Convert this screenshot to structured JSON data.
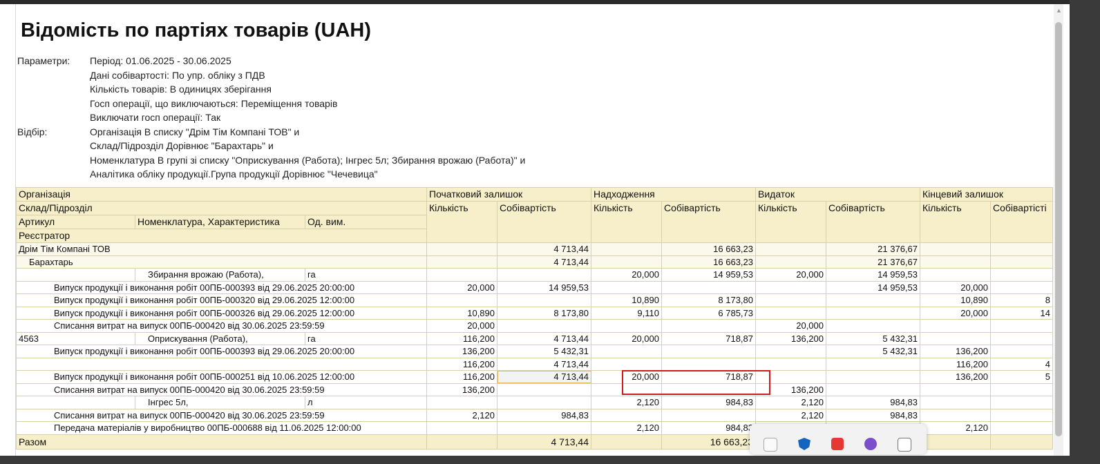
{
  "title": "Відомість по партіях товарів (UAH)",
  "params": [
    {
      "label": "Параметри:",
      "value": "Період: 01.06.2025 - 30.06.2025"
    },
    {
      "label": "",
      "value": "Дані собівартості: По упр. обліку з ПДВ"
    },
    {
      "label": "",
      "value": "Кількість товарів: В одиницях зберігання"
    },
    {
      "label": "",
      "value": "Госп операції, що виключаються: Переміщення товарів"
    },
    {
      "label": "",
      "value": "Виключати госп операції: Так"
    },
    {
      "label": "Відбір:",
      "value": "Організація В списку \"Дрім Тім Компані ТОВ\" и"
    },
    {
      "label": "",
      "value": "Склад/Підрозділ Дорівнює \"Барахтарь\" и"
    },
    {
      "label": "",
      "value": "Номенклатура В групі зі списку \"Оприскування (Работа); Інгрес 5л; Збирання врожаю (Работа)\" и"
    },
    {
      "label": "",
      "value": "Аналітика обліку продукції.Група продукції Дорівнює \"Чечевица\""
    }
  ],
  "header": {
    "organization": "Організація",
    "warehouse": "Склад/Підрозділ",
    "article": "Артикул",
    "nomenclature": "Номенклатура, Характеристика",
    "unit": "Од. вим.",
    "registrar": "Реєстратор",
    "groups": [
      "Початковий залишок",
      "Надходження",
      "Видаток",
      "Кінцевий залишок"
    ],
    "qty": "Кількість",
    "cost": "Собівартість",
    "cost_trunc": "Собівартісті"
  },
  "rows": [
    {
      "kind": "org",
      "label": "Дрім Тім Компані ТОВ",
      "v": [
        "",
        "4 713,44",
        "",
        "16 663,23",
        "",
        "21 376,67",
        "",
        ""
      ]
    },
    {
      "kind": "wh",
      "label": "Барахтарь",
      "v": [
        "",
        "4 713,44",
        "",
        "16 663,23",
        "",
        "21 376,67",
        "",
        ""
      ]
    },
    {
      "kind": "item",
      "article": "",
      "name": "Збирання врожаю (Работа),",
      "unit": "га",
      "v": [
        "",
        "",
        "20,000",
        "14 959,53",
        "20,000",
        "14 959,53",
        "",
        ""
      ]
    },
    {
      "kind": "doc",
      "label": "Випуск продукції і виконання робіт 00ПБ-000393 від 29.06.2025 20:00:00",
      "v": [
        "20,000",
        "14 959,53",
        "",
        "",
        "",
        "14 959,53",
        "20,000",
        ""
      ]
    },
    {
      "kind": "doc",
      "label": "Випуск продукції і виконання робіт 00ПБ-000320 від 29.06.2025 12:00:00",
      "v": [
        "",
        "",
        "10,890",
        "8 173,80",
        "",
        "",
        "10,890",
        "8"
      ]
    },
    {
      "kind": "doc",
      "label": "Випуск продукції і виконання робіт 00ПБ-000326 від 29.06.2025 12:00:00",
      "v": [
        "10,890",
        "8 173,80",
        "9,110",
        "6 785,73",
        "",
        "",
        "20,000",
        "14"
      ]
    },
    {
      "kind": "doc",
      "label": "Списання витрат на випуск 00ПБ-000420 від 30.06.2025 23:59:59",
      "v": [
        "20,000",
        "",
        "",
        "",
        "20,000",
        "",
        "",
        ""
      ]
    },
    {
      "kind": "item",
      "article": "4563",
      "name": "Оприскування (Работа),",
      "unit": "га",
      "v": [
        "116,200",
        "4 713,44",
        "20,000",
        "718,87",
        "136,200",
        "5 432,31",
        "",
        ""
      ]
    },
    {
      "kind": "doc",
      "label": "Випуск продукції і виконання робіт 00ПБ-000393 від 29.06.2025 20:00:00",
      "v": [
        "136,200",
        "5 432,31",
        "",
        "",
        "",
        "5 432,31",
        "136,200",
        ""
      ]
    },
    {
      "kind": "doc",
      "label": "",
      "v": [
        "116,200",
        "4 713,44",
        "",
        "",
        "",
        "",
        "116,200",
        "4"
      ]
    },
    {
      "kind": "doc",
      "label": "Випуск продукції і виконання робіт 00ПБ-000251 від 10.06.2025 12:00:00",
      "v": [
        "116,200",
        "4 713,44",
        "20,000",
        "718,87",
        "",
        "",
        "136,200",
        "5"
      ]
    },
    {
      "kind": "doc",
      "label": "Списання витрат на випуск 00ПБ-000420 від 30.06.2025 23:59:59",
      "v": [
        "136,200",
        "",
        "",
        "",
        "136,200",
        "",
        "",
        ""
      ]
    },
    {
      "kind": "item",
      "article": "",
      "name": "Інгрес 5л,",
      "unit": "л",
      "v": [
        "",
        "",
        "2,120",
        "984,83",
        "2,120",
        "984,83",
        "",
        ""
      ]
    },
    {
      "kind": "doc",
      "label": "Списання витрат на випуск 00ПБ-000420 від 30.06.2025 23:59:59",
      "v": [
        "2,120",
        "984,83",
        "",
        "",
        "2,120",
        "984,83",
        "",
        ""
      ]
    },
    {
      "kind": "doc",
      "label": "Передача матеріалів у виробництво 00ПБ-000688 від 11.06.2025 12:00:00",
      "v": [
        "",
        "",
        "2,120",
        "984,83",
        "",
        "",
        "2,120",
        ""
      ]
    }
  ],
  "total": {
    "label": "Разом",
    "v": [
      "",
      "4 713,44",
      "",
      "16 663,23",
      "",
      "",
      "",
      ""
    ]
  }
}
